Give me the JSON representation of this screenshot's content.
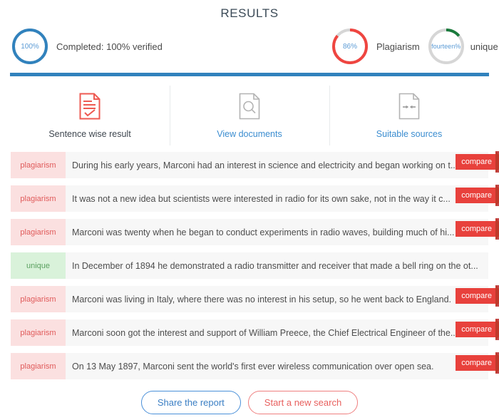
{
  "header": {
    "title": "RESULTS"
  },
  "summary": {
    "completed": {
      "gauge_value": "100%",
      "gauge_percent": 100,
      "gauge_color": "#3182bd",
      "text": "Completed: 100% verified"
    },
    "plagiarism": {
      "gauge_value": "86%",
      "gauge_percent": 86,
      "gauge_color": "#ef4540",
      "text": "Plagiarism"
    },
    "unique": {
      "gauge_value": "fourteen%",
      "gauge_percent": 14,
      "gauge_color": "#1a7a3c",
      "text": "unique"
    },
    "track_color": "#d6d6d6"
  },
  "tabs": [
    {
      "label": "Sentence wise result",
      "icon": "document-check-icon",
      "active": true
    },
    {
      "label": "View documents",
      "icon": "document-search-icon",
      "active": false
    },
    {
      "label": "Suitable sources",
      "icon": "document-arrows-icon",
      "active": false
    }
  ],
  "sentences": [
    {
      "tag": "plagiarism",
      "text": "During his early years, Marconi had an interest in science and electricity and began working on t...",
      "compare_label": "compare",
      "has_compare": true
    },
    {
      "tag": "plagiarism",
      "text": "It was not a new idea but scientists were interested in radio for its own sake, not in the way it c...",
      "compare_label": "compare",
      "has_compare": true
    },
    {
      "tag": "plagiarism",
      "text": "Marconi was twenty when he began to conduct experiments in radio waves, building much of hi...",
      "compare_label": "compare",
      "has_compare": true
    },
    {
      "tag": "unique",
      "text": "In December of 1894 he demonstrated a radio transmitter and receiver that made a bell ring on the ot...",
      "compare_label": "",
      "has_compare": false
    },
    {
      "tag": "plagiarism",
      "text": "Marconi was living in Italy, where there was no interest in his setup, so he went back to England.",
      "compare_label": "compare",
      "has_compare": true
    },
    {
      "tag": "plagiarism",
      "text": "Marconi soon got the interest and support of William Preece, the Chief Electrical Engineer of the...",
      "compare_label": "compare",
      "has_compare": true
    },
    {
      "tag": "plagiarism",
      "text": "On 13 May 1897, Marconi sent the world's first ever wireless communication over open sea.",
      "compare_label": "compare",
      "has_compare": true
    }
  ],
  "footer": {
    "share_label": "Share the report",
    "new_search_label": "Start a new search"
  }
}
